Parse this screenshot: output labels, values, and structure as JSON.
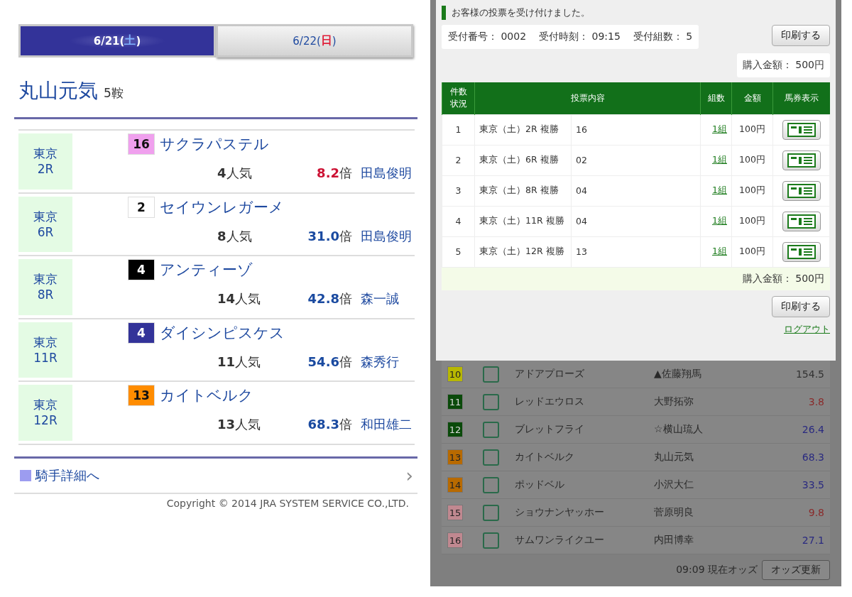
{
  "jockey_page": {
    "tabs": [
      {
        "prefix": "6/21(",
        "day": {
          "text": "土",
          "color": "#7fb2ff"
        },
        "suffix": ")",
        "selected": true
      },
      {
        "prefix": "6/22(",
        "day": {
          "text": "日",
          "color": "#e0203a"
        },
        "suffix": ")",
        "selected": false
      }
    ],
    "title": "丸山元気",
    "ride_count": "5鞍",
    "rides": [
      {
        "venue": "東京",
        "race": "2R",
        "badge": {
          "text": "16",
          "color": "#f0a0ee"
        },
        "horse": "サクラパステル",
        "popularity": "4",
        "popularity_unit": "人気",
        "odds": {
          "text": "8.2",
          "color": "#cc1133"
        },
        "odds_unit": "倍",
        "jockey": "田島俊明"
      },
      {
        "venue": "東京",
        "race": "6R",
        "badge": {
          "text": "2",
          "color": "#ffffff"
        },
        "horse": "セイウンレガーメ",
        "popularity": "8",
        "popularity_unit": "人気",
        "odds": {
          "text": "31.0",
          "color": "#1a4aa0"
        },
        "odds_unit": "倍",
        "jockey": "田島俊明"
      },
      {
        "venue": "東京",
        "race": "8R",
        "badge": {
          "text": "4",
          "color": "#000000"
        },
        "horse": "アンティーゾ",
        "popularity": "14",
        "popularity_unit": "人気",
        "odds": {
          "text": "42.8",
          "color": "#1a4aa0"
        },
        "odds_unit": "倍",
        "jockey": "森一誠"
      },
      {
        "venue": "東京",
        "race": "11R",
        "badge": {
          "text": "4",
          "color": "#333399"
        },
        "horse": "ダイシンピスケス",
        "popularity": "11",
        "popularity_unit": "人気",
        "odds": {
          "text": "54.6",
          "color": "#1a4aa0"
        },
        "odds_unit": "倍",
        "jockey": "森秀行"
      },
      {
        "venue": "東京",
        "race": "12R",
        "badge": {
          "text": "13",
          "color": "#ff8c00"
        },
        "horse": "カイトベルク",
        "popularity": "13",
        "popularity_unit": "人気",
        "odds": {
          "text": "68.3",
          "color": "#1a4aa0"
        },
        "odds_unit": "倍",
        "jockey": "和田雄二"
      }
    ],
    "detail_link": "騎手詳細へ",
    "chevron": "›",
    "copyright": "Copyright © 2014 JRA SYSTEM SERVICE CO.,LTD."
  },
  "vote_dialog": {
    "message": "お客様の投票を受け付けました。",
    "receipt": [
      {
        "label": "受付番号：",
        "value": "0002"
      },
      {
        "label": "受付時刻：",
        "value": "09:15"
      },
      {
        "label": "受付組数：",
        "value": "5"
      }
    ],
    "print_button": "印刷する",
    "total": "購入金額： 500円",
    "columns": [
      "件数状況",
      "投票内容",
      "組数",
      "金額",
      "馬券表示"
    ],
    "rows": [
      {
        "no": "1",
        "race": "東京（土）2R 複勝",
        "selection": "16",
        "count": "1組",
        "amount": "100円"
      },
      {
        "no": "2",
        "race": "東京（土）6R 複勝",
        "selection": "02",
        "count": "1組",
        "amount": "100円"
      },
      {
        "no": "3",
        "race": "東京（土）8R 複勝",
        "selection": "04",
        "count": "1組",
        "amount": "100円"
      },
      {
        "no": "4",
        "race": "東京（土）11R 複勝",
        "selection": "04",
        "count": "1組",
        "amount": "100円"
      },
      {
        "no": "5",
        "race": "東京（土）12R 複勝",
        "selection": "13",
        "count": "1組",
        "amount": "100円"
      }
    ],
    "footer_total": "購入金額： 500円",
    "footer_print_button": "印刷する",
    "logout": "ログアウト"
  },
  "odds_table": {
    "rows": [
      {
        "number": "10",
        "color": "#b8b800",
        "horse": "アドアプローズ",
        "jockey": "▲佐藤翔馬",
        "odds": {
          "text": "154.5",
          "color": "#333333"
        },
        "checked": false
      },
      {
        "number": "11",
        "color": "#0a4a0a",
        "horse": "レッドエウロス",
        "jockey": "大野拓弥",
        "odds": {
          "text": "3.8",
          "color": "#8a2a2a"
        },
        "checked": false
      },
      {
        "number": "12",
        "color": "#0a4a0a",
        "horse": "ブレットフライ",
        "jockey": "☆横山琉人",
        "odds": {
          "text": "26.4",
          "color": "#2a2a80"
        },
        "checked": false
      },
      {
        "number": "13",
        "color": "#b86a00",
        "horse": "カイトベルク",
        "jockey": "丸山元気",
        "odds": {
          "text": "68.3",
          "color": "#2a2a80"
        },
        "checked": false
      },
      {
        "number": "14",
        "color": "#b86a00",
        "horse": "ポッドベル",
        "jockey": "小沢大仁",
        "odds": {
          "text": "33.5",
          "color": "#2a2a80"
        },
        "checked": false
      },
      {
        "number": "15",
        "color": "#c08890",
        "horse": "ショウナンヤッホー",
        "jockey": "菅原明良",
        "odds": {
          "text": "9.8",
          "color": "#8a2a2a"
        },
        "checked": false
      },
      {
        "number": "16",
        "color": "#c08890",
        "horse": "サムワンライクユー",
        "jockey": "内田博幸",
        "odds": {
          "text": "27.1",
          "color": "#2a2a80"
        },
        "checked": false
      }
    ],
    "updated": "09:09 現在オッズ",
    "refresh_button": "オッズ更新"
  }
}
